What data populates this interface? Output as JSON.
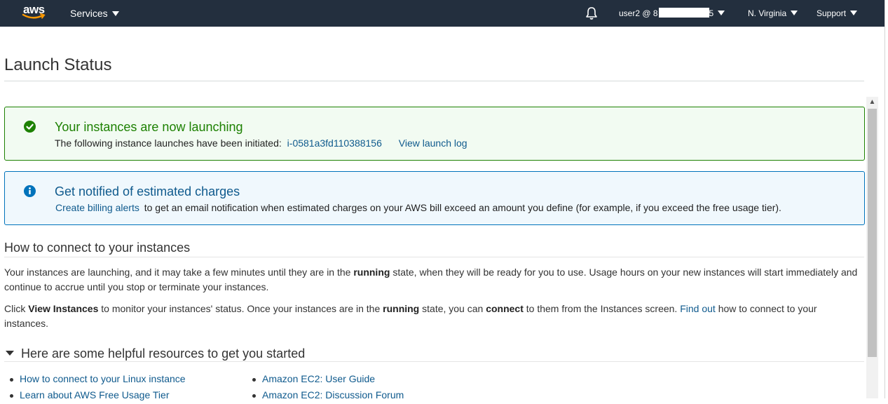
{
  "nav": {
    "logo_text": "aws",
    "services_label": "Services",
    "account_label": "user2 @ 8",
    "account_tail": "5",
    "region_label": "N. Virginia",
    "support_label": "Support"
  },
  "page": {
    "title": "Launch Status"
  },
  "success_alert": {
    "heading": "Your instances are now launching",
    "body_text": "The following instance launches have been initiated:",
    "instance_id": "i-0581a3fd110388156",
    "log_link": "View launch log"
  },
  "info_alert": {
    "heading": "Get notified of estimated charges",
    "link_text": "Create billing alerts",
    "body_text": "to get an email notification when estimated charges on your AWS bill exceed an amount you define (for example, if you exceed the free usage tier)."
  },
  "connect": {
    "title": "How to connect to your instances",
    "p1_a": "Your instances are launching, and it may take a few minutes until they are in the ",
    "p1_bold": "running",
    "p1_b": " state, when they will be ready for you to use. Usage hours on your new instances will start immediately and continue to accrue until you stop or terminate your instances.",
    "p2_a": "Click ",
    "p2_bold1": "View Instances",
    "p2_b": " to monitor your instances' status. Once your instances are in the ",
    "p2_bold2": "running",
    "p2_c": " state, you can ",
    "p2_bold3": "connect",
    "p2_d": " to them from the Instances screen. ",
    "p2_link": "Find out",
    "p2_e": " how to connect to your instances."
  },
  "resources": {
    "title": "Here are some helpful resources to get you started",
    "col1": [
      "How to connect to your Linux instance",
      "Learn about AWS Free Usage Tier"
    ],
    "col2": [
      "Amazon EC2: User Guide",
      "Amazon EC2: Discussion Forum"
    ]
  },
  "colors": {
    "nav_bg": "#232f3e",
    "success": "#1d8102",
    "info": "#0073bb",
    "link": "#0f5a8d"
  }
}
